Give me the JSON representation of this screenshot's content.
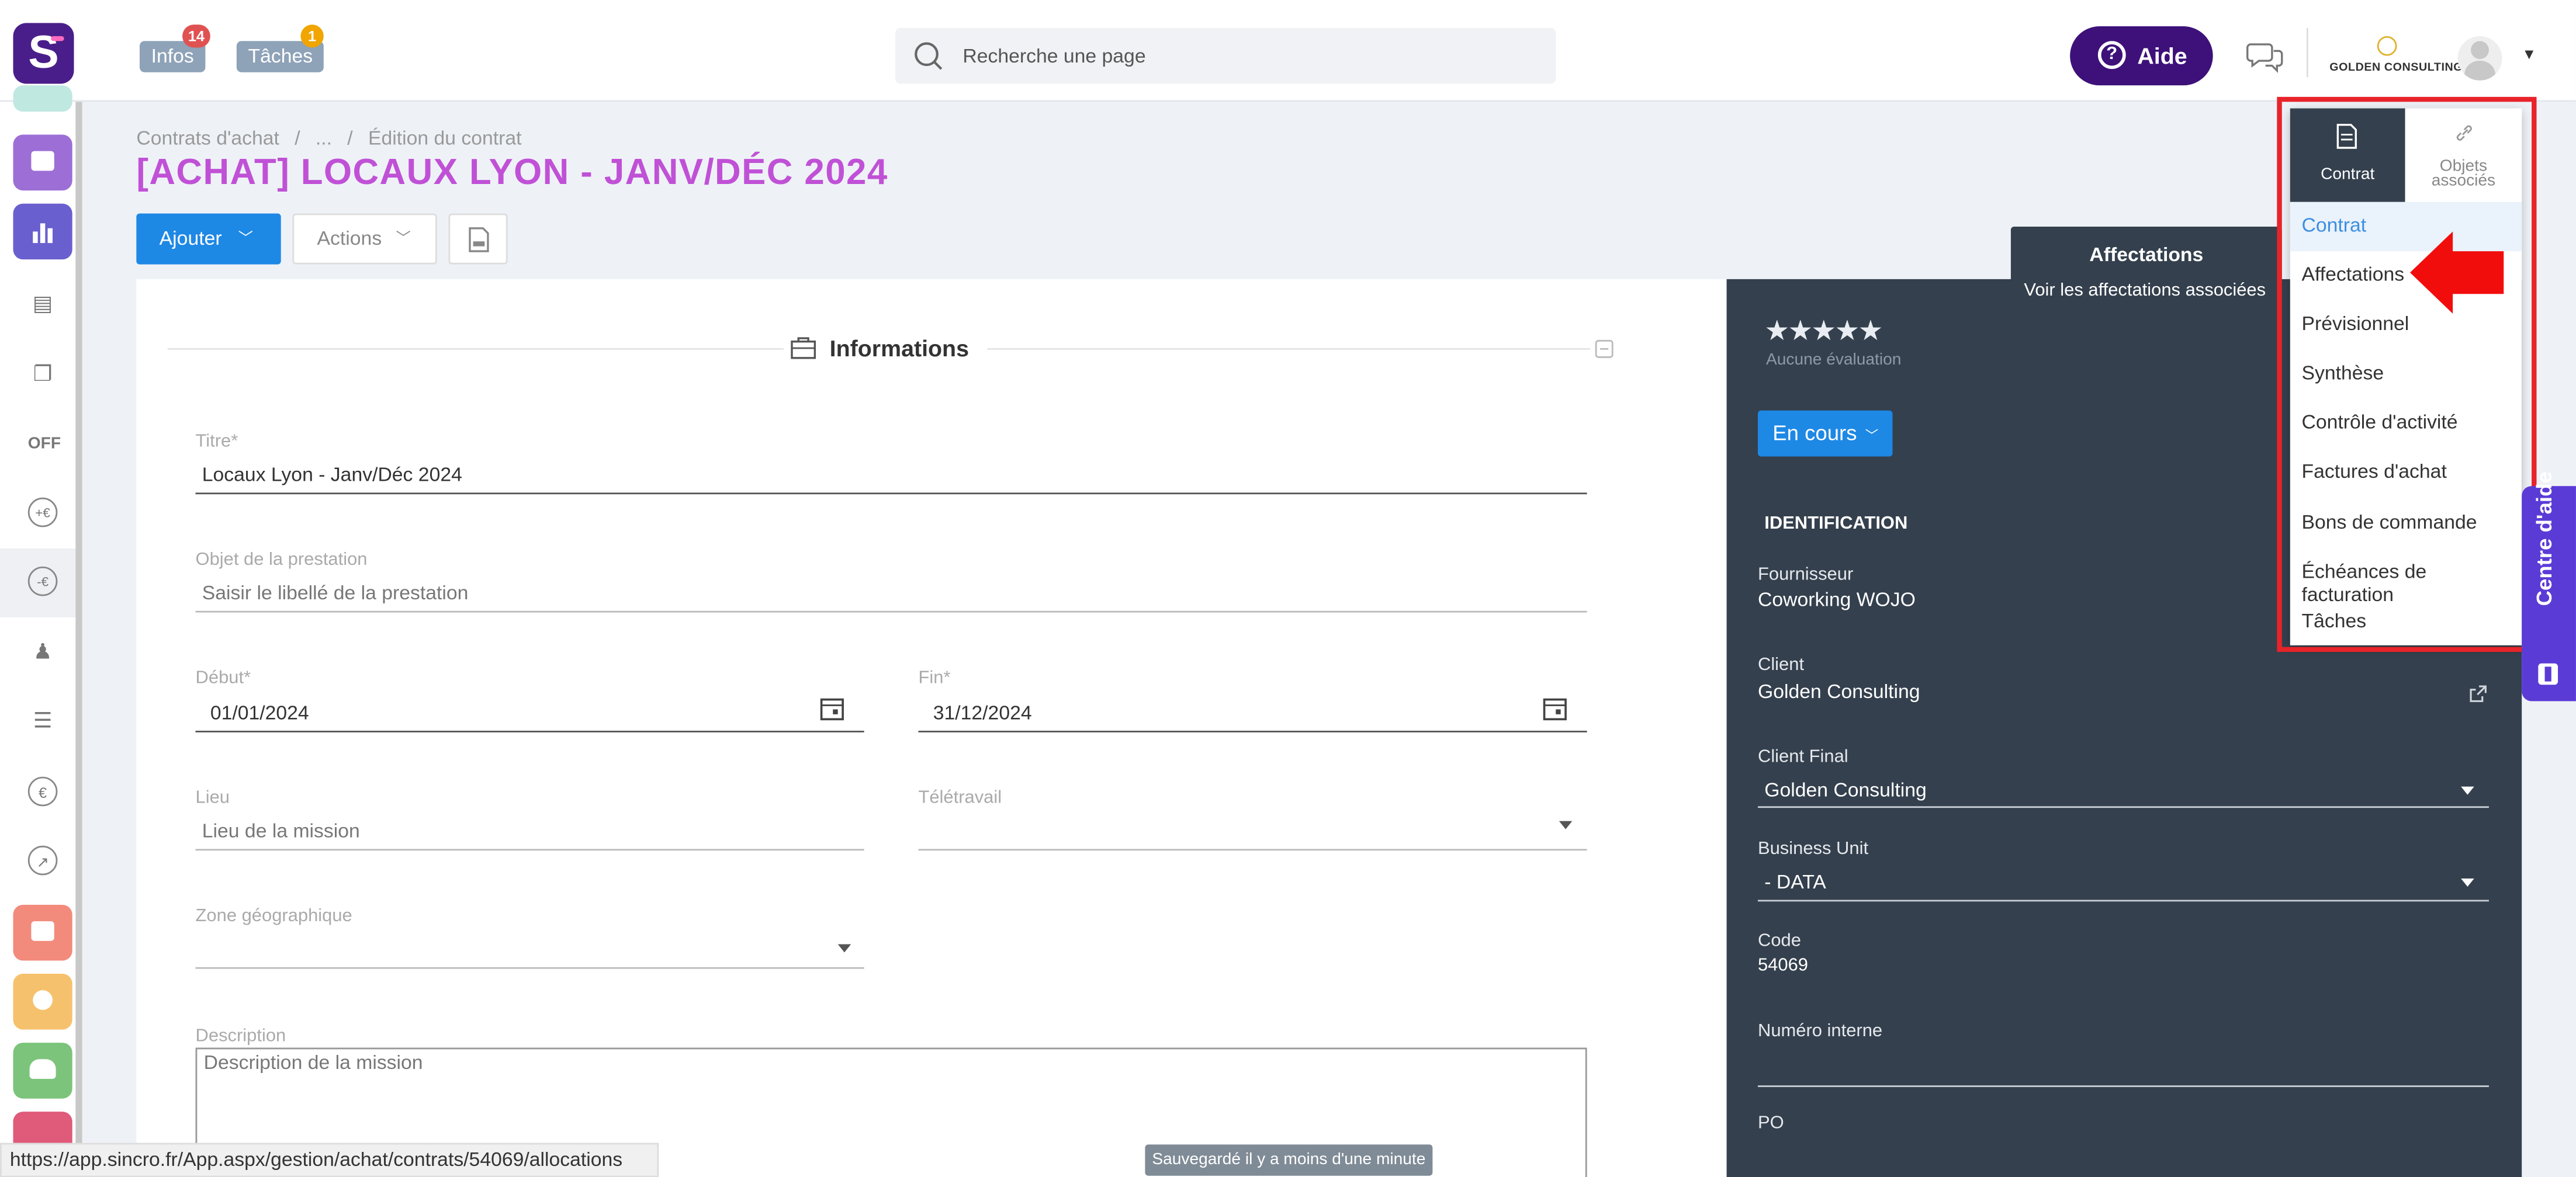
{
  "topbar": {
    "logo_letter": "S",
    "infos_label": "Infos",
    "infos_count": "14",
    "taches_label": "Tâches",
    "taches_count": "1",
    "search_placeholder": "Recherche une page",
    "aide_label": "Aide",
    "company": "GOLDEN CONSULTING"
  },
  "breadcrumb": {
    "item1": "Contrats d'achat",
    "sep1": "/",
    "item2": "...",
    "sep2": "/",
    "item3": "Édition du contrat"
  },
  "page_title": "[ACHAT] LOCAUX LYON - JANV/DÉC 2024",
  "toolbar": {
    "ajouter_label": "Ajouter",
    "actions_label": "Actions"
  },
  "form": {
    "section_title": "Informations",
    "titre_label": "Titre*",
    "titre_value": "Locaux Lyon - Janv/Déc 2024",
    "objet_label": "Objet de la prestation",
    "objet_placeholder": "Saisir le libellé de la prestation",
    "debut_label": "Début*",
    "debut_value": "01/01/2024",
    "fin_label": "Fin*",
    "fin_value": "31/12/2024",
    "lieu_label": "Lieu",
    "lieu_placeholder": "Lieu de la mission",
    "teletravail_label": "Télétravail",
    "zone_label": "Zone géographique",
    "description_label": "Description",
    "description_placeholder": "Description de la mission"
  },
  "panel": {
    "stars": "★★★★★",
    "evaluation": "Aucune évaluation",
    "status_button": "En cours",
    "identification_heading": "IDENTIFICATION",
    "fournisseur_label": "Fournisseur",
    "fournisseur_value": "Coworking WOJO",
    "client_label": "Client",
    "client_value": "Golden Consulting",
    "client_final_label": "Client Final",
    "client_final_value": "Golden Consulting",
    "bu_label": "Business Unit",
    "bu_value": "- DATA",
    "code_label": "Code",
    "code_value": "54069",
    "numero_label": "Numéro interne",
    "po_label": "PO"
  },
  "tooltip": {
    "title": "Affectations",
    "text": "Voir les affectations associées"
  },
  "menu": {
    "tab_contrat": "Contrat",
    "tab_objets_line1": "Objets",
    "tab_objets_line2": "associés",
    "items": [
      "Contrat",
      "Affectations",
      "Prévisionnel",
      "Synthèse",
      "Contrôle d'activité",
      "Factures d'achat",
      "Bons de commande",
      "Échéances de facturation",
      "Tâches"
    ]
  },
  "centre_aide": "Centre d'aide",
  "statusbar_url": "https://app.sincro.fr/App.aspx/gestion/achat/contrats/54069/allocations",
  "saved_toast": "Sauvegardé il y a moins d'une minute",
  "colors": {
    "brand": "#4a1e8a",
    "title": "#c051d6",
    "primary": "#1e88e5",
    "panel": "#34404d",
    "highlight": "#e8232a"
  }
}
